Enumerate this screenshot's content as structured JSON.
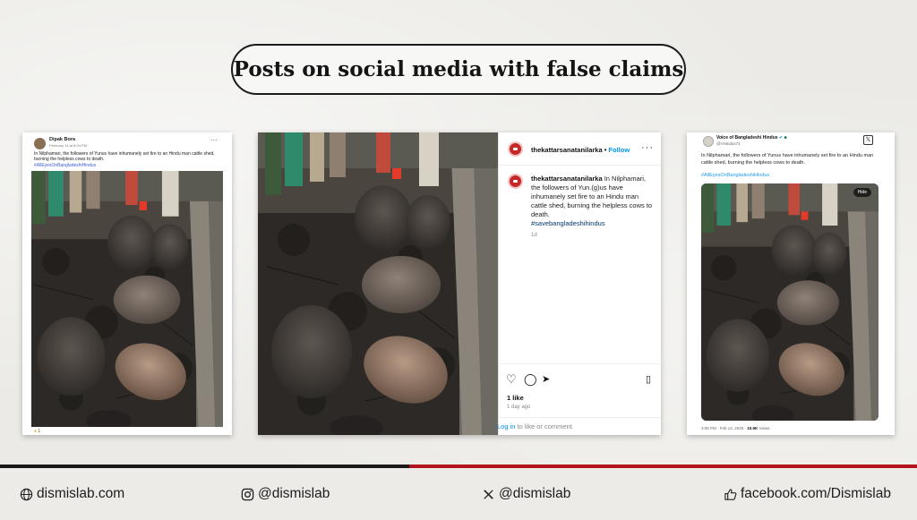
{
  "title": "Posts on social media with false claims",
  "facebook_post": {
    "name": "Dipak Bora",
    "date": "February 14 at 8:04 PM · ",
    "text": "In Nilphamari, the followers of Yunus have inhumanely set fire to an Hindu man cattle shed, burning the helpless cows to death.",
    "hashtag": "#AllEyesOnBangladeshiHindus",
    "reactions": "1",
    "menu": "···"
  },
  "instagram_post": {
    "username": "thekattarsanatanilarka",
    "separator": " • ",
    "follow": "Follow",
    "menu": "···",
    "caption": "In Nilphamari, the followers of Yun.(g)us have inhumanely set fire to an Hindu man cattle shed, burning the helpless cows to death.",
    "hashtag": "#savebangladeshihindus",
    "age": "1d",
    "likes": "1 like",
    "ago": "1 day ago",
    "login_link": "Log in",
    "login_rest": " to like or comment."
  },
  "x_post": {
    "name": "Voice of Bangladeshi Hindus",
    "handle": "@VHindus71",
    "text": "In Nilphamari, the followers of Yunus have inhumanely set fire to an Hindu man cattle shed, burning the helpless cows to death.",
    "hashtag": "#AllEyesOnBangladeshiHindus",
    "hide": "Hide",
    "time": "3:05 PM · Feb 14, 2025 · ",
    "views_count": "10.9K",
    "views_label": " Views"
  },
  "footer": {
    "website": "dismislab.com",
    "instagram": "@dismislab",
    "x": "@dismislab",
    "facebook": "facebook.com/Dismislab"
  },
  "colors": {
    "accent_red": "#b3141b",
    "divider_dark": "#1a1a1a",
    "instagram_blue": "#0095f6",
    "x_blue": "#1d9bf0"
  }
}
